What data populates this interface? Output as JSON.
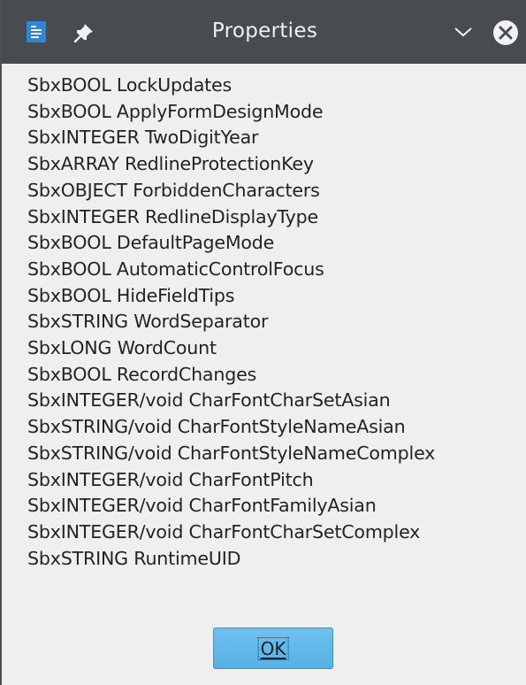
{
  "window": {
    "title": "Properties"
  },
  "icons": {
    "app": "document-app-icon",
    "pin": "pin-icon",
    "chevron": "chevron-down-icon",
    "close": "close-icon"
  },
  "properties": [
    "SbxBOOL LockUpdates",
    "SbxBOOL ApplyFormDesignMode",
    "SbxINTEGER TwoDigitYear",
    "SbxARRAY RedlineProtectionKey",
    "SbxOBJECT ForbiddenCharacters",
    "SbxINTEGER RedlineDisplayType",
    "SbxBOOL DefaultPageMode",
    "SbxBOOL AutomaticControlFocus",
    "SbxBOOL HideFieldTips",
    "SbxSTRING WordSeparator",
    "SbxLONG WordCount",
    "SbxBOOL RecordChanges",
    "SbxINTEGER/void CharFontCharSetAsian",
    "SbxSTRING/void CharFontStyleNameAsian",
    "SbxSTRING/void CharFontStyleNameComplex",
    "SbxINTEGER/void CharFontPitch",
    "SbxINTEGER/void CharFontFamilyAsian",
    "SbxINTEGER/void CharFontCharSetComplex",
    "SbxSTRING RuntimeUID"
  ],
  "buttons": {
    "ok_label": "OK"
  },
  "colors": {
    "titlebar": "#484c51",
    "window_bg": "#efefef",
    "ok_button": "#5cb6ea"
  }
}
